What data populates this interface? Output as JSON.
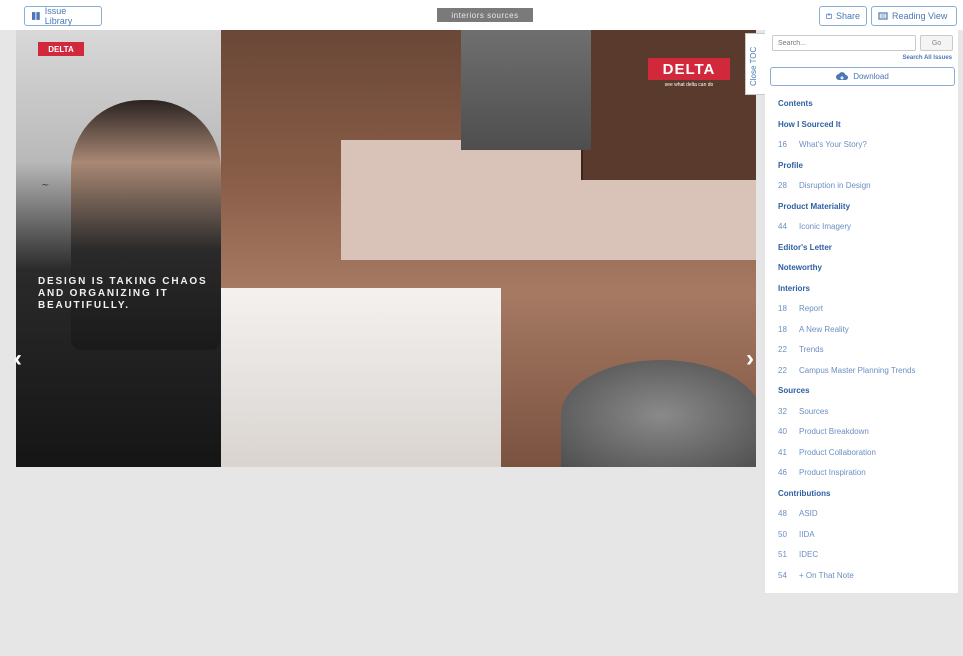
{
  "topbar": {
    "library_label": "Issue Library",
    "logo_text": "interiors sources",
    "share_label": "Share",
    "reading_label": "Reading View"
  },
  "viewer": {
    "toc_tab_label": "Close TOC"
  },
  "spread": {
    "left_brand": "DELTA",
    "right_brand": "DELTA",
    "right_brand_sub": "see what delta can do",
    "headline": "DESIGN IS TAKING CHAOS AND ORGANIZING IT BEAUTIFULLY."
  },
  "sidebar": {
    "search_placeholder": "Search...",
    "search_button": "Go",
    "search_all": "Search All Issues",
    "download_label": "Download",
    "toc": [
      {
        "type": "section",
        "title": "Contents"
      },
      {
        "type": "section",
        "title": "How I Sourced It"
      },
      {
        "type": "item",
        "page": "16",
        "title": "What's Your Story?"
      },
      {
        "type": "section",
        "title": "Profile"
      },
      {
        "type": "item",
        "page": "28",
        "title": "Disruption in Design"
      },
      {
        "type": "section",
        "title": "Product Materiality"
      },
      {
        "type": "item",
        "page": "44",
        "title": "Iconic Imagery"
      },
      {
        "type": "section",
        "title": "Editor's Letter"
      },
      {
        "type": "section",
        "title": "Noteworthy"
      },
      {
        "type": "section",
        "title": "Interiors"
      },
      {
        "type": "item",
        "page": "18",
        "title": "Report"
      },
      {
        "type": "item",
        "page": "18",
        "title": "A New Reality"
      },
      {
        "type": "item",
        "page": "22",
        "title": "Trends"
      },
      {
        "type": "item",
        "page": "22",
        "title": "Campus Master Planning Trends"
      },
      {
        "type": "section",
        "title": "Sources"
      },
      {
        "type": "item",
        "page": "32",
        "title": "Sources"
      },
      {
        "type": "item",
        "page": "40",
        "title": "Product Breakdown"
      },
      {
        "type": "item",
        "page": "41",
        "title": "Product Collaboration"
      },
      {
        "type": "item",
        "page": "46",
        "title": "Product Inspiration"
      },
      {
        "type": "section",
        "title": "Contributions"
      },
      {
        "type": "item",
        "page": "48",
        "title": "ASID"
      },
      {
        "type": "item",
        "page": "50",
        "title": "IIDA"
      },
      {
        "type": "item",
        "page": "51",
        "title": "IDEC"
      },
      {
        "type": "item",
        "page": "54",
        "title": "+ On That Note"
      }
    ]
  },
  "colors": {
    "accent": "#4a78b5",
    "toc_section": "#2e5fa3",
    "brand_red": "#d2283c"
  },
  "icons": {
    "library": "book-icon",
    "share": "share-icon",
    "reading": "reading-view-icon",
    "download": "cloud-download-icon",
    "prev": "chevron-left-icon",
    "next": "chevron-right-icon"
  }
}
